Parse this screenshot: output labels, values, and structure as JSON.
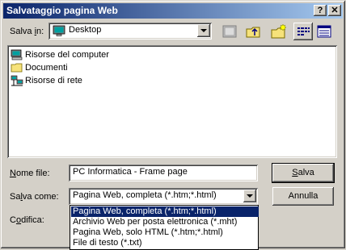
{
  "window": {
    "title": "Salvataggio pagina Web",
    "help_button": "?",
    "close_button": "✕"
  },
  "save_in": {
    "label_pre": "Salva ",
    "label_key": "i",
    "label_post": "n:",
    "value": "Desktop"
  },
  "files": [
    {
      "label": "Risorse del computer",
      "icon": "my-computer-icon"
    },
    {
      "label": "Documenti",
      "icon": "folder-icon"
    },
    {
      "label": "Risorse di rete",
      "icon": "network-icon"
    }
  ],
  "filename": {
    "label_key": "N",
    "label_post": "ome file:",
    "value": "PC Informatica - Frame page"
  },
  "save_as": {
    "label_pre": "Sa",
    "label_key": "l",
    "label_post": "va come:",
    "value": "Pagina Web, completa (*.htm;*.html)",
    "options": [
      "Pagina Web, completa (*.htm;*.html)",
      "Archivio Web per posta elettronica (*.mht)",
      "Pagina Web, solo HTML (*.htm;*.html)",
      "File di testo (*.txt)"
    ],
    "selected_index": 0
  },
  "encoding": {
    "label_pre": "C",
    "label_key": "o",
    "label_post": "difica:"
  },
  "buttons": {
    "save_key": "S",
    "save_post": "alva",
    "cancel": "Annulla"
  },
  "colors": {
    "title_start": "#0a246a",
    "title_end": "#a6caf0",
    "face": "#d4d0c8",
    "selection": "#0a246a"
  }
}
